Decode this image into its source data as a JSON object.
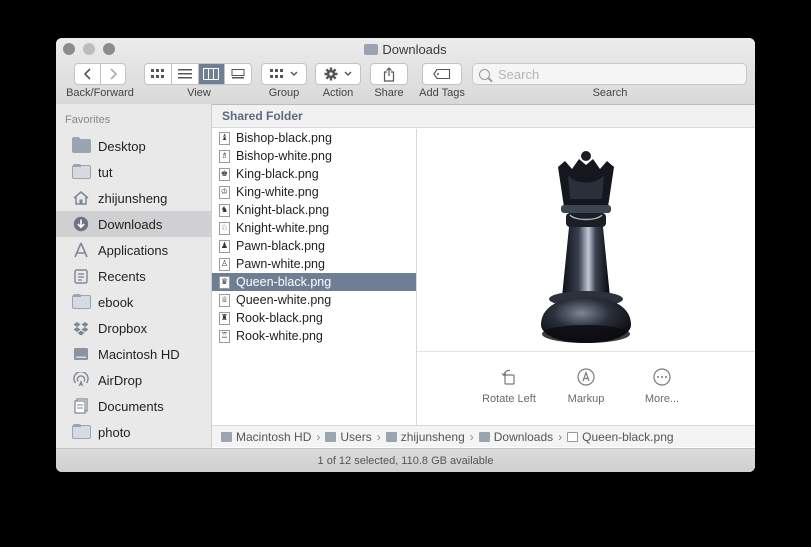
{
  "window": {
    "title": "Downloads"
  },
  "toolbar": {
    "back_forward_label": "Back/Forward",
    "view_label": "View",
    "group_label": "Group",
    "action_label": "Action",
    "share_label": "Share",
    "add_tags_label": "Add Tags",
    "search_label": "Search",
    "search_placeholder": "Search"
  },
  "sidebar": {
    "heading": "Favorites",
    "items": [
      {
        "label": "Desktop",
        "icon": "folder-icon"
      },
      {
        "label": "tut",
        "icon": "folder-icon"
      },
      {
        "label": "zhijunsheng",
        "icon": "home-icon"
      },
      {
        "label": "Downloads",
        "icon": "downloads-icon",
        "selected": true
      },
      {
        "label": "Applications",
        "icon": "applications-icon"
      },
      {
        "label": "Recents",
        "icon": "recents-icon"
      },
      {
        "label": "ebook",
        "icon": "folder-icon"
      },
      {
        "label": "Dropbox",
        "icon": "dropbox-icon"
      },
      {
        "label": "Macintosh HD",
        "icon": "disk-icon"
      },
      {
        "label": "AirDrop",
        "icon": "airdrop-icon"
      },
      {
        "label": "Documents",
        "icon": "documents-icon"
      },
      {
        "label": "photo",
        "icon": "folder-icon"
      }
    ]
  },
  "main": {
    "header": "Shared Folder",
    "files": [
      {
        "name": "Bishop-black.png"
      },
      {
        "name": "Bishop-white.png"
      },
      {
        "name": "King-black.png"
      },
      {
        "name": "King-white.png"
      },
      {
        "name": "Knight-black.png"
      },
      {
        "name": "Knight-white.png"
      },
      {
        "name": "Pawn-black.png"
      },
      {
        "name": "Pawn-white.png"
      },
      {
        "name": "Queen-black.png",
        "selected": true
      },
      {
        "name": "Queen-white.png"
      },
      {
        "name": "Rook-black.png"
      },
      {
        "name": "Rook-white.png"
      }
    ],
    "preview": {
      "image": "queen-black-chess-piece",
      "actions": [
        {
          "label": "Rotate Left",
          "icon": "rotate-left-icon"
        },
        {
          "label": "Markup",
          "icon": "markup-icon"
        },
        {
          "label": "More...",
          "icon": "more-icon"
        }
      ]
    }
  },
  "pathbar": [
    "Macintosh HD",
    "Users",
    "zhijunsheng",
    "Downloads",
    "Queen-black.png"
  ],
  "status": "1 of 12 selected, 110.8 GB available",
  "colors": {
    "selection": "#6f7e95",
    "sidebar_bg": "#e9e9ea",
    "accent_header": "#5a6a80"
  }
}
